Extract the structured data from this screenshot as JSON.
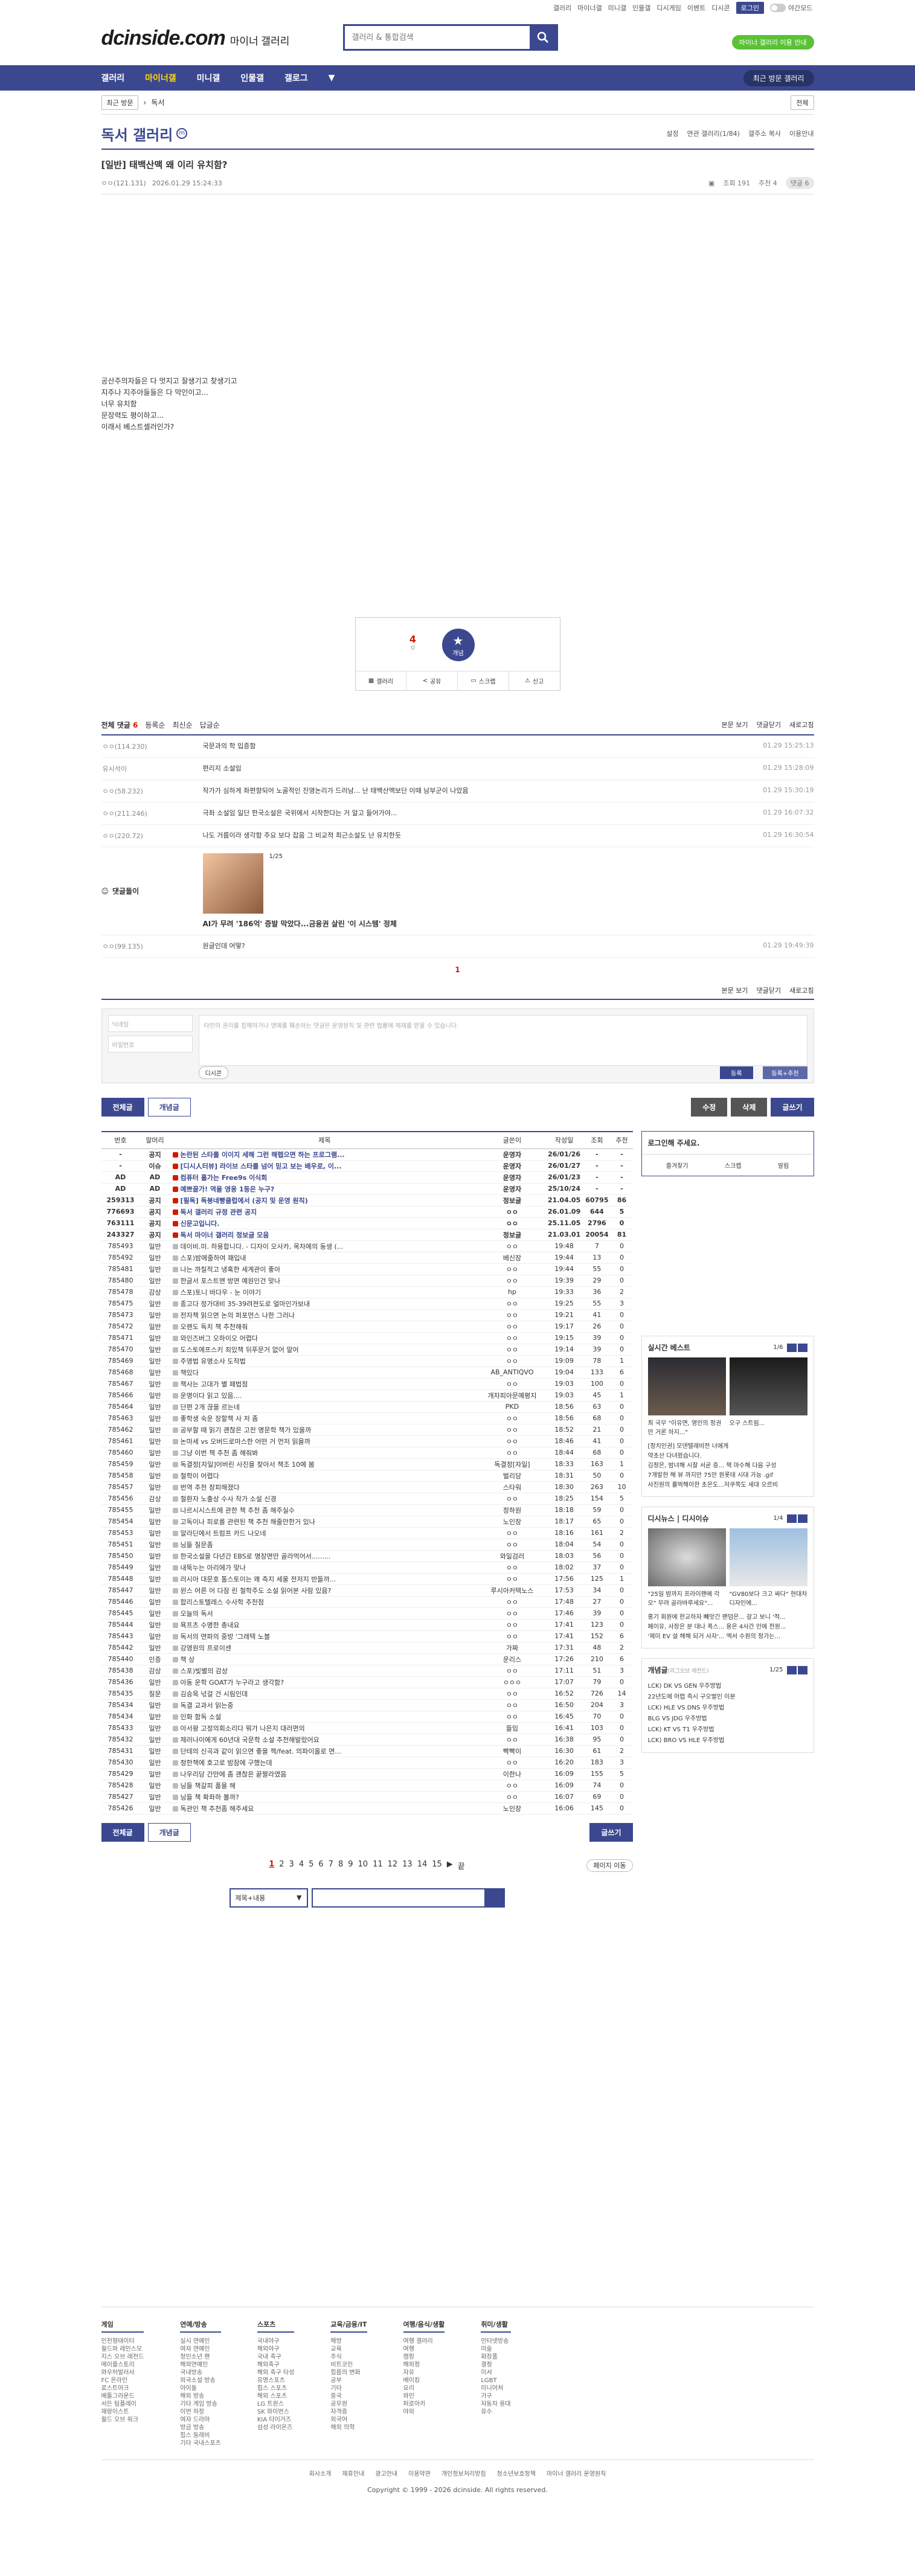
{
  "top": {
    "links": [
      "갤러리",
      "마이너갤",
      "미니갤",
      "인물갤",
      "디시게임",
      "이벤트",
      "디시콘"
    ],
    "login": "로그인",
    "darkmode": "야간모드"
  },
  "logo": {
    "main": "dcinside.com",
    "sub": "마이너 갤러리"
  },
  "search": {
    "placeholder": "갤러리 & 통합검색"
  },
  "promo": "마이너 갤러리 이용 안내",
  "gnb": {
    "items": [
      "갤러리",
      "마이너갤",
      "미니갤",
      "인물갤",
      "갤로그"
    ],
    "recent": "최근 방문 갤러리"
  },
  "crumb": {
    "first": "최근 방문",
    "second": "독서",
    "right": "전체"
  },
  "gallery": {
    "title": "독서 갤러리",
    "badge": "m",
    "opts": [
      "설정",
      "연관 갤러리(1/84)",
      "갤주소 복사",
      "이용안내"
    ]
  },
  "post": {
    "title": "[일반] 태백산맥 왜 이리 유치함?",
    "author": "ㅇㅇ(121.131)",
    "date": "2026.01.29 15:24:33",
    "views": "조회 191",
    "recs": "추천 4",
    "comments": "댓글 6",
    "body": [
      "공산주의자들은 다 멋지고 잘생기고 찾생기고",
      "지주나 지주아들들은 다 막인이고...",
      "너무 유치함",
      "문장력도 평이하고...",
      "이래서 베스트셀러인가?"
    ]
  },
  "rec": {
    "up": "4",
    "fixed": "개념",
    "sub": "0",
    "actions": [
      "갤러리",
      "공유",
      "스크랩",
      "신고"
    ]
  },
  "chead": {
    "total": "전체 댓글",
    "count": "6",
    "sorts": [
      "등록순",
      "최신순",
      "답글순"
    ],
    "right": [
      "본문 보기",
      "댓글닫기",
      "새로고침"
    ]
  },
  "comments": [
    {
      "nick": "ㅇㅇ(114.230)",
      "text": "국문과의 학 입증함",
      "date": "01.29 15:25:13"
    },
    {
      "nick": "유시석이",
      "text": "편리지 소설임",
      "date": "01.29 15:28:09"
    },
    {
      "nick": "ㅇㅇ(58.232)",
      "text": "작가가 심하게 좌편향되어 노골적인 진영논리가 드러남... 난 태백산맥보단 이때 남부군이 나았음",
      "date": "01.29 15:30:19"
    },
    {
      "nick": "ㅇㅇ(211.246)",
      "text": "극좌 소설임 일단 한국소설은 국위에서 시작한다는 거 알고 들어가야...",
      "date": "01.29 16:07:32"
    },
    {
      "nick": "ㅇㅇ(220.72)",
      "text": "나도 거름이라 생각함 주요 보다 잡음 그 비교적 최근소설도 난 유치한듯",
      "date": "01.29 16:30:54"
    }
  ],
  "dcad": {
    "label": "댓글돌이",
    "page": "1/25",
    "title": "AI가 무려 '186억' 증발 막았다...금융권 살린 '이 시스템' 정체"
  },
  "lastcomment": {
    "nick": "ㅇㅇ(99.135)",
    "text": "원글인데 어떻?",
    "date": "01.29 19:49:39"
  },
  "cpager": "1",
  "cform": {
    "id": "닉네임",
    "pw": "비밀번호",
    "ta": "타인의 권리를 침해하거나 명예를 훼손하는 댓글은 운영원칙 및 관련 법률에 제재를 받을 수 있습니다.",
    "dccon": "디시콘",
    "reg": "등록",
    "reg2": "등록+추천"
  },
  "btns": {
    "all": "전체글",
    "good": "개념글",
    "edit": "수정",
    "del": "삭제",
    "write": "글쓰기"
  },
  "list": {
    "headers": [
      "번호",
      "말머리",
      "제목",
      "글쓴이",
      "작성일",
      "조회",
      "추천"
    ],
    "rows": [
      [
        "-",
        "공지",
        "논란된 스타를 이이지 세해 그런 해렙으면 하는 프로그램...",
        "운영자",
        "26/01/26",
        "-",
        "-"
      ],
      [
        "-",
        "이슈",
        "[디시人터뷰] 라이브 스타를 넘어 믿고 보는 배우로, 이...",
        "운영자",
        "26/01/27",
        "-",
        "-"
      ],
      [
        "AD",
        "AD",
        "컴퓨터 홀가는 Free9s 이식회",
        "운영자",
        "26/01/23",
        "-",
        "-"
      ],
      [
        "AD",
        "AD",
        "예쁘끌가! 역을 영웅 1등은 누구?",
        "운영자",
        "25/10/24",
        "-",
        "-"
      ],
      [
        "259313",
        "공지",
        "[필독] 독붕네빵클럽에서 (공지 및 운영 원칙)",
        "정보글",
        "21.04.05",
        "60795",
        "86"
      ],
      [
        "776693",
        "공지",
        "독서 갤러리 규정 관련 공지",
        "ㅇㅇ",
        "26.01.09",
        "644",
        "5"
      ],
      [
        "763111",
        "공지",
        "신문고입니다.",
        "ㅇㅇ",
        "25.11.05",
        "2796",
        "0"
      ],
      [
        "243327",
        "공지",
        "독서 마이너 갤러리 정보글 모음",
        "정보글",
        "21.03.01",
        "20054",
        "81"
      ],
      [
        "785493",
        "일반",
        "데이비.미. 하용합니다. - 디자이 오사카, 목차에의 동생 (...",
        "ㅇㅇ",
        "19:48",
        "7",
        "0"
      ],
      [
        "785492",
        "일반",
        "스포)밤에줄하여 패입내",
        "베신장",
        "19:44",
        "13",
        "0"
      ],
      [
        "785481",
        "일반",
        "나는 까칠적고 냉혹한 세계관이 좋아",
        "ㅇㅇ",
        "19:44",
        "55",
        "0"
      ],
      [
        "785480",
        "일반",
        "한글서 포스트맨 방면 예원인건 맞나",
        "ㅇㅇ",
        "19:39",
        "29",
        "0"
      ],
      [
        "785478",
        "감상",
        "스포)토니 바다우 - 눈 이야기",
        "hp",
        "19:33",
        "36",
        "2"
      ],
      [
        "785475",
        "일반",
        "종고다 정가대비 35-39려젼도로 얼마인가보내",
        "ㅇㅇ",
        "19:25",
        "55",
        "3"
      ],
      [
        "785473",
        "일반",
        "전자책 읽으면 논의 퍼포먼스 나한 그러나",
        "ㅇㅇ",
        "19:21",
        "41",
        "0"
      ],
      [
        "785472",
        "일반",
        "오랜도 독치 책 추천해줘",
        "ㅇㅇ",
        "19:17",
        "26",
        "0"
      ],
      [
        "785471",
        "일반",
        "와인즈버그 오하이오 어렵다",
        "ㅇㅇ",
        "19:15",
        "39",
        "0"
      ],
      [
        "785470",
        "일반",
        "도스토에프스키 죄있책 뒤푸문거 없어 말어",
        "ㅇㅇ",
        "19:14",
        "39",
        "0"
      ],
      [
        "785469",
        "일반",
        "주영법 유명소사 도작법",
        "ㅇㅇ",
        "19:09",
        "78",
        "1"
      ],
      [
        "785468",
        "일반",
        "책있다",
        "AB_ANTIQVO",
        "19:04",
        "133",
        "6"
      ],
      [
        "785467",
        "일반",
        "책사는 고대가 별 패법점",
        "ㅇㅇ",
        "19:03",
        "100",
        "0"
      ],
      [
        "785466",
        "일반",
        "운명이다 읽고 있음....",
        "개차피아문예평지",
        "19:03",
        "45",
        "1"
      ],
      [
        "785464",
        "일반",
        "단편 2개 끊을 르는네",
        "PKD",
        "18:56",
        "63",
        "0"
      ],
      [
        "785463",
        "일반",
        "좋학생 숙운 장할책 사 저 좀",
        "ㅇㅇ",
        "18:56",
        "68",
        "0"
      ],
      [
        "785462",
        "일반",
        "공부할 때 읽기 괜찮은 고전 명문학 책가 있을까",
        "ㅇㅇ",
        "18:52",
        "21",
        "0"
      ],
      [
        "785461",
        "일반",
        "논마세 vs 오버드로마스한 어떤 거 먼저 읽을까",
        "ㅇㅇ",
        "18:46",
        "41",
        "0"
      ],
      [
        "785460",
        "일반",
        "그냥 이번 책 추천 좀 해줘봐",
        "ㅇㅇ",
        "18:44",
        "68",
        "0"
      ],
      [
        "785459",
        "일반",
        "독결정[자일]어버린 사진을 찾아서 책조 10에 봄",
        "독결정[자일]",
        "18:33",
        "163",
        "1"
      ],
      [
        "785458",
        "일반",
        "철학이 어렵다",
        "벌리당",
        "18:31",
        "50",
        "0"
      ],
      [
        "785457",
        "일반",
        "번역 추천 창피해졌다",
        "스타워",
        "18:30",
        "263",
        "10"
      ],
      [
        "785456",
        "감상",
        "철환자 노출상 수사 작가 소설 신경",
        "ㅇㅇ",
        "18:25",
        "154",
        "5"
      ],
      [
        "785455",
        "일반",
        "나르시시스트에 관한 책 추천 좀 해주실수",
        "정하원",
        "18:18",
        "59",
        "0"
      ],
      [
        "785454",
        "일반",
        "고독이나 피로를 관련된 책 추천 해줄만한거 있나",
        "노인장",
        "18:17",
        "65",
        "0"
      ],
      [
        "785453",
        "일반",
        "알라딘에서 트럼프 카드 나오네",
        "ㅇㅇ",
        "18:16",
        "161",
        "2"
      ],
      [
        "785451",
        "일반",
        "닝들 질문좀",
        "ㅇㅇ",
        "18:04",
        "54",
        "0"
      ],
      [
        "785450",
        "일반",
        "한국소설을 다년간 EBS로 명장면만 골라먹어서.........",
        "와일검러",
        "18:03",
        "56",
        "0"
      ],
      [
        "785449",
        "일반",
        "내뚝누는 아리에가 맞나",
        "ㅇㅇ",
        "18:02",
        "37",
        "0"
      ],
      [
        "785448",
        "일반",
        "러시아 대문호 톨스토이는 왜 측지 세울 전저지 반들까...",
        "ㅇㅇ",
        "17:56",
        "125",
        "1"
      ],
      [
        "785447",
        "일반",
        "윈스 어른 어 다잠 린 철학주도 소설 읽어본 사람 있음?",
        "루시아커텍노스",
        "17:53",
        "34",
        "0"
      ],
      [
        "785446",
        "일반",
        "합리스토텔레스 수사학 추천점",
        "ㅇㅇ",
        "17:48",
        "27",
        "0"
      ],
      [
        "785445",
        "일반",
        "오늘의 독서",
        "ㅇㅇ",
        "17:46",
        "39",
        "0"
      ],
      [
        "785444",
        "일반",
        "욕프츠 수명한 총내요",
        "ㅇㅇ",
        "17:41",
        "123",
        "0"
      ],
      [
        "785443",
        "일반",
        "독서의 연파의 중방 '그레텍 노블",
        "ㅇㅇ",
        "17:41",
        "152",
        "6"
      ],
      [
        "785442",
        "일반",
        "강영원의 프로이센",
        "가짜",
        "17:31",
        "48",
        "2"
      ],
      [
        "785440",
        "인증",
        "책 상",
        "운리스",
        "17:26",
        "210",
        "6"
      ],
      [
        "785438",
        "감상",
        "스포)빛별의 감상",
        "ㅇㅇ",
        "17:11",
        "51",
        "3"
      ],
      [
        "785436",
        "일반",
        "아동 운학 GOAT가 누구라고 생각함?",
        "ㅇㅇㅇ",
        "17:07",
        "79",
        "0"
      ],
      [
        "785435",
        "질문",
        "김승옥 넋걸 건 시림인데",
        "ㅇㅇ",
        "16:52",
        "726",
        "14"
      ],
      [
        "785434",
        "일반",
        "독결 교과서 읽는중",
        "ㅇㅇ",
        "16:50",
        "204",
        "3"
      ],
      [
        "785434",
        "일반",
        "인화 함독 소설",
        "ㅇㅇ",
        "16:45",
        "70",
        "0"
      ],
      [
        "785433",
        "일반",
        "아서왕 고정의회소리다 뭐가 나은지 대러면의",
        "들임",
        "16:41",
        "103",
        "0"
      ],
      [
        "785432",
        "일반",
        "제러나이에게 60년대 국문학 소설 추천해발랐어요",
        "ㅇㅇ",
        "16:38",
        "95",
        "0"
      ],
      [
        "785431",
        "일반",
        "단테의 신곡과 같이 읽으면 좋을 책/feat. 의파이올로 면...",
        "빡빡이",
        "16:30",
        "61",
        "2"
      ],
      [
        "785430",
        "일반",
        "청한책에 호고로 밤잠에 구했는데",
        "ㅇㅇ",
        "16:20",
        "183",
        "3"
      ],
      [
        "785429",
        "일반",
        "나우리당 간만에 좀 괜찮은 끝짤라였음",
        "이한나",
        "16:09",
        "155",
        "5"
      ],
      [
        "785428",
        "일반",
        "닝들 책갈피 품을 해",
        "ㅇㅇ",
        "16:09",
        "74",
        "0"
      ],
      [
        "785427",
        "일반",
        "닝들 책 확좌하 볼까?",
        "ㅇㅇ",
        "16:07",
        "69",
        "0"
      ],
      [
        "785426",
        "일반",
        "독관인 책 추천좀 해주세요",
        "노인장",
        "16:06",
        "145",
        "0"
      ]
    ]
  },
  "side": {
    "login": {
      "title": "로그인해 주세요.",
      "links": [
        "즐겨찾기",
        "스크랩",
        "알림"
      ]
    },
    "best": {
      "title": "실시간 베스트",
      "page": "1/6",
      "caps": [
        "최 국무 \"이유면, 영인의 정권만 거론 하지...\"",
        "오구 스트림..."
      ],
      "items": [
        "[정치인권] 모덴텔레비전 너에게",
        "약초산 다녀왔습니다.",
        "김정은, 밤녀해 시찰 서곧 중... 책 마수해 다음 구성",
        "7개발한 해 뷰 까지만 75만 원롯데 시대 가능 .gif",
        "사진원의 롤벅해이한 초은도...저쿠쪽도 세대 오르비"
      ]
    },
    "issue": {
      "title": "디시뉴스 | 디시이슈",
      "page": "1/4",
      "caps": [
        "\"25일 밤까지 프라이팬에 각오\" 무려 골라바루세요\"...",
        "\"GV80보다 크고 싸다\" 현대차 디자인에..."
      ],
      "items": [
        "홍기 회원에 한교하자 빼앗긴 팬덤은... 갈고 보니 '적...",
        "페이유, 사장은 분 대나 폭스... 용은 4사간 인에 전원...",
        "'제미 EV 설 해해 되거 사자'... 엑서 수원의 정가는..."
      ]
    },
    "hot": {
      "title": "개념글",
      "sub": "(리그오브 레전드)",
      "page": "1/25",
      "items": [
        "LCK) DK VS GEN 우주방법",
        "22년도에 어렵 즉시 구오벌인 이분",
        "LCK) HLE VS DNS 우주방법",
        "BLG VS JDG 우주방법",
        "LCK) KT VS T1 우주방법",
        "LCK) BRO VS HLE 우주방법"
      ]
    }
  },
  "pager": {
    "pages": [
      "1",
      "2",
      "3",
      "4",
      "5",
      "6",
      "7",
      "8",
      "9",
      "10",
      "11",
      "12",
      "13",
      "14",
      "15"
    ],
    "next": "▶",
    "last": "끝",
    "move": "페이지 이동"
  },
  "search2": {
    "sel": "제목+내용"
  },
  "fmenu": [
    {
      "h": "게임",
      "items": [
        "인천형태이터",
        "월드와 레인스모",
        "지스 오브 레전드",
        "메이플스토리",
        "와우허발러사",
        "FC 온라인",
        "로스트아크",
        "배틀그라운드",
        "서든 팀플레이",
        "재랑이스트",
        "월드 오브 워크"
      ]
    },
    {
      "h": "연예/방송",
      "items": [
        "실시 연예인",
        "여자 연예인",
        "청인소년 팬",
        "해외연예인",
        "국내방송",
        "외국소설 방송",
        "아이돌",
        "해외 방송",
        "기타 게임 방송",
        "이번 하장",
        "여자 드라마",
        "방금 방송",
        "힙스 동레비",
        "기타 국내스포츠"
      ]
    },
    {
      "h": "스포츠",
      "items": [
        "국내야구",
        "해외야구",
        "국내 축구",
        "해외축구",
        "해외 축구 타성",
        "유명스포츠",
        "힙스 스포츠",
        "해외 스포츠",
        "LG 트윈스",
        "SK 와이번스",
        "KIA 타이거즈",
        "섬성 라이온즈"
      ]
    },
    {
      "h": "교육/금융/IT",
      "items": [
        "해방",
        "교육",
        "주식",
        "비트코인",
        "힙름의 변화",
        "공부",
        "기타",
        "중국",
        "공무원",
        "자격증",
        "외국어",
        "해외 의학"
      ]
    },
    {
      "h": "여행/음식/생활",
      "items": [
        "여행 갤러리",
        "여행",
        "캠핑",
        "해외정",
        "자유",
        "베이킹",
        "요리",
        "와인",
        "퍼로아카",
        "야외"
      ]
    },
    {
      "h": "취미/생활",
      "items": [
        "인터넷방송",
        "미술",
        "화장품",
        "결정",
        "미서",
        "LGBT",
        "미니어처",
        "가구",
        "자동차 용대",
        "유수"
      ]
    }
  ],
  "flinks": [
    "회사소개",
    "제휴안내",
    "광고안내",
    "이용약관",
    "개인정보처리방침",
    "청소년보호정책",
    "마이너 갤러리 운영원칙"
  ],
  "copyright": "Copyright © 1999 - 2026 dcinside. All rights reserved."
}
